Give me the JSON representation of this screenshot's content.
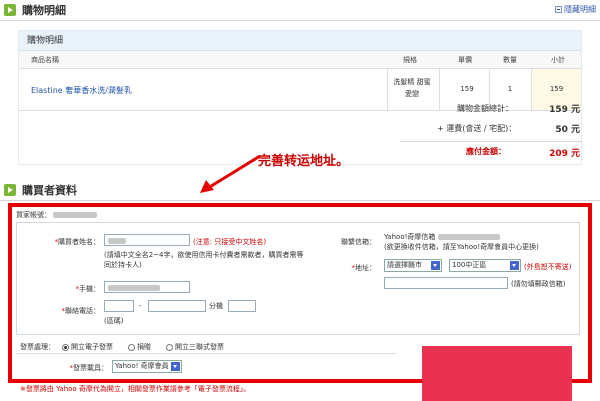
{
  "cart_section": {
    "title": "購物明細",
    "toggle_label": "隱藏明細",
    "table_caption": "購物明細",
    "columns": [
      "商品名稱",
      "規格",
      "單價",
      "數量",
      "小計"
    ],
    "items": [
      {
        "name": "Elastine 奢華香水洗/潤髮乳",
        "spec": "洗髮精 甜蜜愛戀",
        "price": "159",
        "qty": "1",
        "subtotal": "159"
      }
    ],
    "totals": {
      "goods_label": "購物金額總計：",
      "goods_value": "159 元",
      "shipping_label": "+ 運費(會送 / 宅配)：",
      "shipping_value": "50 元",
      "grand_label": "應付金額：",
      "grand_value": "209 元"
    }
  },
  "annotation": {
    "text": "完善转运地址。",
    "color": "#cc0000"
  },
  "buyer_section": {
    "title": "購買者資料",
    "account_label": "買家帳號：",
    "name_label": "購買者姓名：",
    "name_warning": "(注意: 只接受中文姓名)",
    "name_hint": "(請填中文全名2~4字，欲使用信用卡付費者需款者，購買者需等同於持卡人)",
    "mobile_label": "手機：",
    "phone_label": "聯絡電話：",
    "phone_dash": "-",
    "ext_label": "分機",
    "area_code_label": "(區碼)",
    "email_label": "聯繫信箱：",
    "email_prefix": "Yahoo!奇摩信箱",
    "email_hint": "(欲更換收件信箱，請至Yahoo!奇摩會員中心更換)",
    "address_label": "地址：",
    "city_value": "請選擇縣市",
    "district_value": "100中正區",
    "island_warning": "(外島恕不寄送)",
    "address_hint": "(請勿填郵政信箱)",
    "invoice_label": "發票處理：",
    "invoice_options": [
      {
        "label": "開立電子發票",
        "selected": true
      },
      {
        "label": "捐贈",
        "selected": false
      },
      {
        "label": "開立三聯式發票",
        "selected": false
      }
    ],
    "carrier_label": "發票載具：",
    "carrier_value": "Yahoo! 奇摩會員",
    "footnote_prefix": "※發票將由 Yahoo 奇摩代為開立，相關發票作業請參考「",
    "footnote_link": "電子發票流程",
    "footnote_suffix": "」。"
  },
  "colors": {
    "accent_green": "#7bb534",
    "highlight_red": "#e60000",
    "link_blue": "#2255aa"
  }
}
